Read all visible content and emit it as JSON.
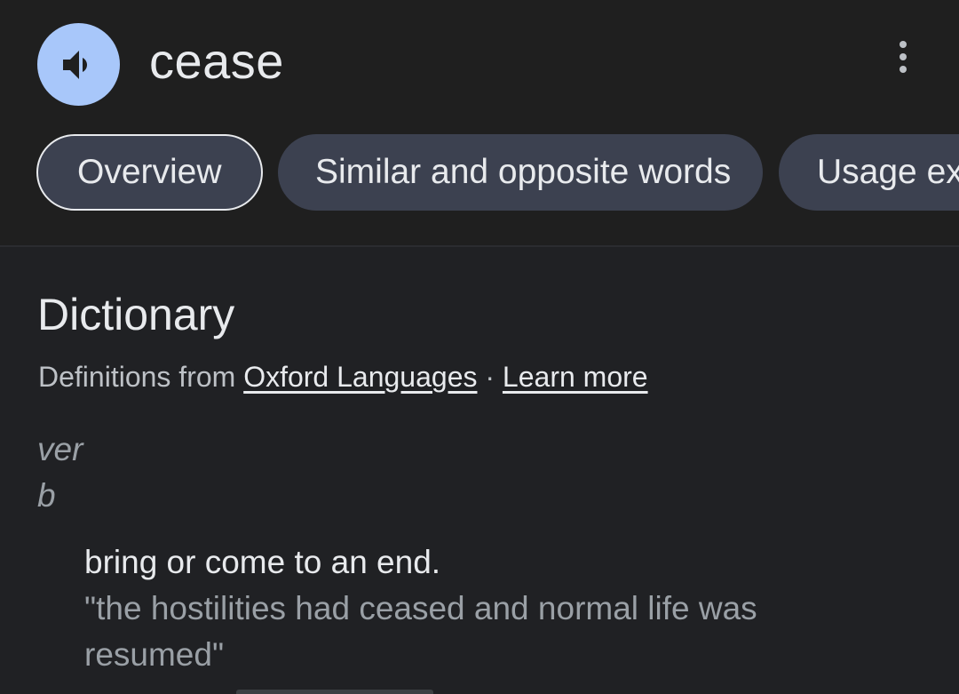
{
  "header": {
    "headword": "cease",
    "speaker_icon": "speaker-icon",
    "more_icon": "more-vert-icon"
  },
  "tabs": [
    {
      "label": "Overview",
      "selected": true
    },
    {
      "label": "Similar and opposite words",
      "selected": false
    },
    {
      "label": "Usage ex",
      "selected": false
    }
  ],
  "dictionary": {
    "title": "Dictionary",
    "source_prefix": "Definitions from",
    "source_link": "Oxford Languages",
    "separator": "·",
    "learn_more": "Learn more",
    "part_of_speech": "verb",
    "definition": "bring or come to an end.",
    "example": "\"the hostilities had ceased and normal life was resumed\""
  },
  "colors": {
    "background": "#202124",
    "speaker_button": "#a8c7fa",
    "tab_background": "#3c4150"
  }
}
